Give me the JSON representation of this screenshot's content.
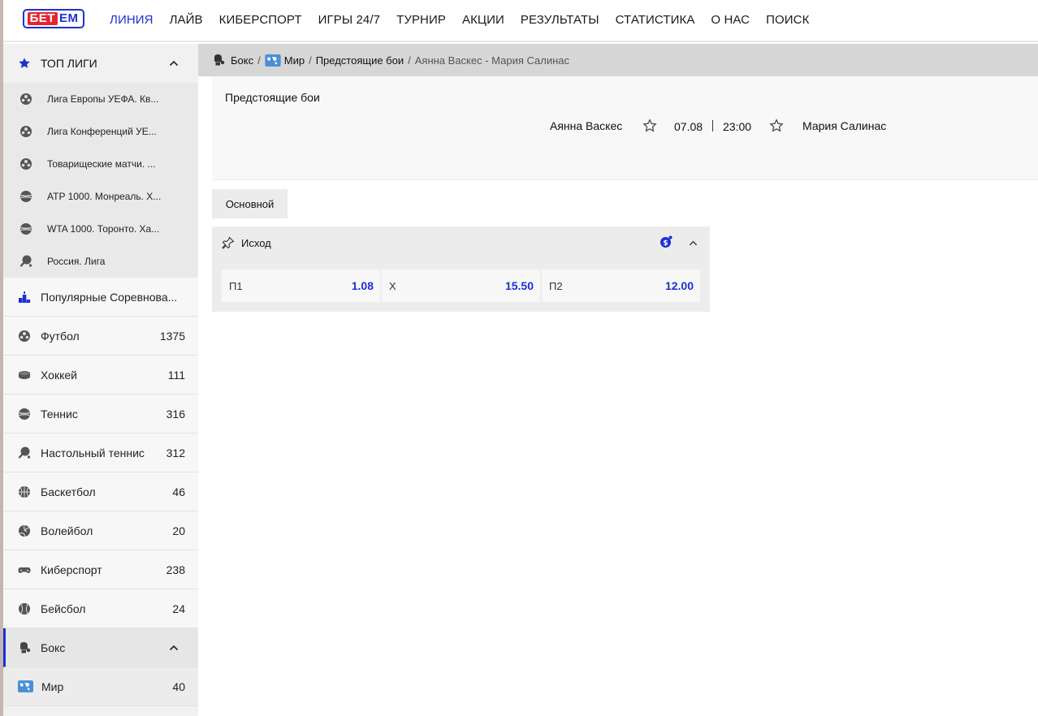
{
  "colors": {
    "accent": "#1f2fd6",
    "logo_red": "#e3262e"
  },
  "logo": {
    "part1": "БЕТ",
    "part2": "ЕМ"
  },
  "nav": [
    "ЛИНИЯ",
    "ЛАЙВ",
    "КИБЕРСПОРТ",
    "ИГРЫ 24/7",
    "ТУРНИР",
    "АКЦИИ",
    "РЕЗУЛЬТАТЫ",
    "СТАТИСТИКА",
    "О НАС",
    "ПОИСК"
  ],
  "sidebar": {
    "top_title": "ТОП ЛИГИ",
    "leagues": [
      {
        "label": "Лига Европы УЕФА. Кв...",
        "icon": "football-icon"
      },
      {
        "label": "Лига Конференций УЕ...",
        "icon": "football-icon"
      },
      {
        "label": "Товарищеские матчи. ...",
        "icon": "football-icon"
      },
      {
        "label": "ATP 1000. Монреаль. Х...",
        "icon": "tennis-icon"
      },
      {
        "label": "WTA 1000. Торонто. Ха...",
        "icon": "tennis-icon"
      },
      {
        "label": "Россия. Лига",
        "icon": "table-tennis-icon"
      }
    ],
    "popular": "Популярные Соревнова...",
    "sports": [
      {
        "label": "Футбол",
        "count": "1375",
        "icon": "football-icon"
      },
      {
        "label": "Хоккей",
        "count": "111",
        "icon": "hockey-puck-icon"
      },
      {
        "label": "Теннис",
        "count": "316",
        "icon": "tennis-icon"
      },
      {
        "label": "Настольный теннис",
        "count": "312",
        "icon": "table-tennis-icon"
      },
      {
        "label": "Баскетбол",
        "count": "46",
        "icon": "basketball-icon"
      },
      {
        "label": "Волейбол",
        "count": "20",
        "icon": "volleyball-icon"
      },
      {
        "label": "Киберспорт",
        "count": "238",
        "icon": "gamepad-icon"
      },
      {
        "label": "Бейсбол",
        "count": "24",
        "icon": "baseball-icon"
      }
    ],
    "active_sport": "Бокс",
    "sub_item": {
      "label": "Мир",
      "count": "40"
    }
  },
  "breadcrumb": {
    "sport": "Бокс",
    "region": "Мир",
    "category": "Предстоящие бои",
    "current": "Аянна Васкес - Мария Салинас",
    "sep": "/"
  },
  "event": {
    "category": "Предстоящие бои",
    "team1": "Аянна Васкес",
    "team2": "Мария Салинас",
    "date": "07.08",
    "time": "23:00"
  },
  "tab": "Основной",
  "market": {
    "title": "Исход",
    "odds": [
      {
        "label": "П1",
        "value": "1.08"
      },
      {
        "label": "Х",
        "value": "15.50"
      },
      {
        "label": "П2",
        "value": "12.00"
      }
    ]
  }
}
